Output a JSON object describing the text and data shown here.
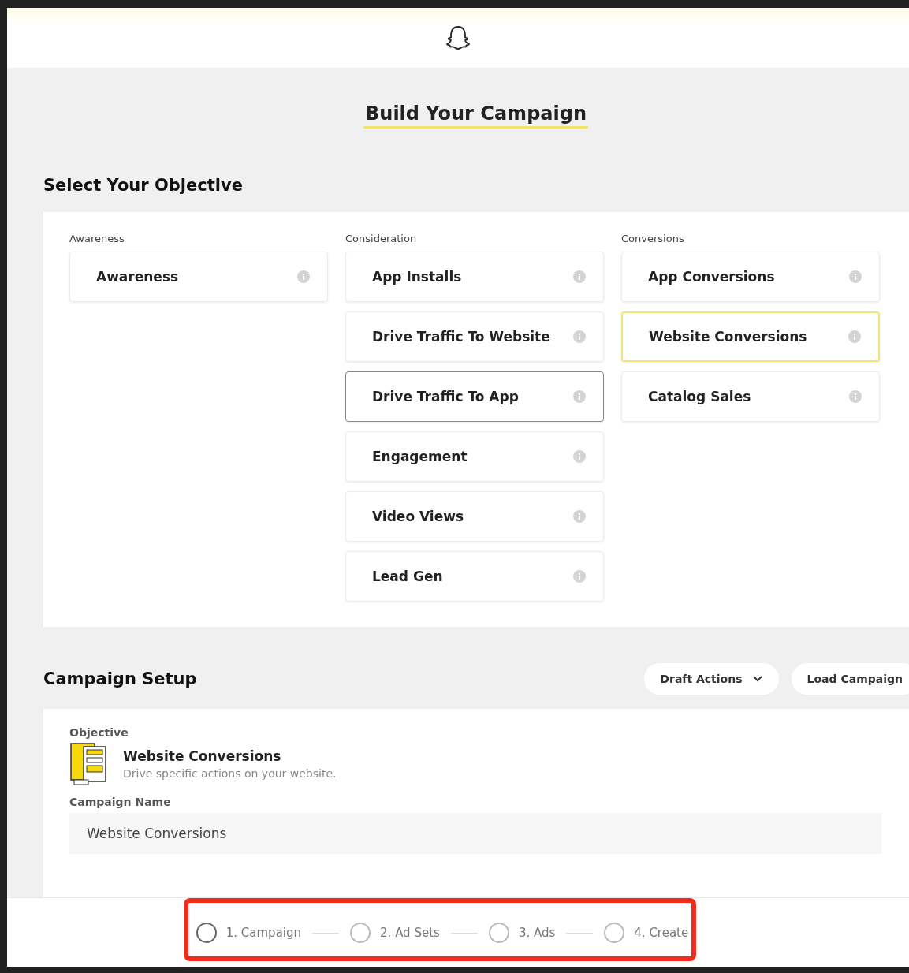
{
  "page": {
    "title": "Build Your Campaign"
  },
  "objective_section": {
    "heading": "Select Your Objective",
    "groups": [
      {
        "label": "Awareness",
        "items": [
          {
            "label": "Awareness",
            "selected": false,
            "hovered": false
          }
        ]
      },
      {
        "label": "Consideration",
        "items": [
          {
            "label": "App Installs",
            "selected": false,
            "hovered": false
          },
          {
            "label": "Drive Traffic To Website",
            "selected": false,
            "hovered": false
          },
          {
            "label": "Drive Traffic To App",
            "selected": false,
            "hovered": true
          },
          {
            "label": "Engagement",
            "selected": false,
            "hovered": false
          },
          {
            "label": "Video Views",
            "selected": false,
            "hovered": false
          },
          {
            "label": "Lead Gen",
            "selected": false,
            "hovered": false
          }
        ]
      },
      {
        "label": "Conversions",
        "items": [
          {
            "label": "App Conversions",
            "selected": false,
            "hovered": false
          },
          {
            "label": "Website Conversions",
            "selected": true,
            "hovered": false
          },
          {
            "label": "Catalog Sales",
            "selected": false,
            "hovered": false
          }
        ]
      }
    ]
  },
  "campaign_setup": {
    "heading": "Campaign Setup",
    "buttons": [
      {
        "label": "Draft Actions",
        "kind": "dropdown"
      },
      {
        "label": "Load Campaign",
        "kind": "plain"
      }
    ],
    "objective_label": "Objective",
    "objective_name": "Website Conversions",
    "objective_description": "Drive specific actions on your website.",
    "name_label": "Campaign Name",
    "name_value": "Website Conversions"
  },
  "steps": [
    {
      "label": "1. Campaign",
      "selected": true
    },
    {
      "label": "2. Ad Sets",
      "selected": false
    },
    {
      "label": "3. Ads",
      "selected": false
    },
    {
      "label": "4. Create",
      "selected": false
    }
  ]
}
